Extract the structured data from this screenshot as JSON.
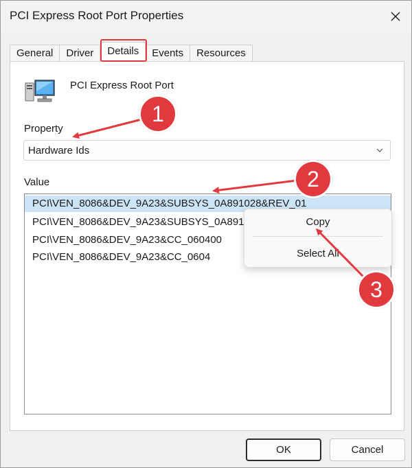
{
  "window": {
    "title": "PCI Express Root Port Properties",
    "close_glyph": "✕"
  },
  "tabs": [
    {
      "label": "General",
      "active": false
    },
    {
      "label": "Driver",
      "active": false
    },
    {
      "label": "Details",
      "active": true
    },
    {
      "label": "Events",
      "active": false
    },
    {
      "label": "Resources",
      "active": false
    }
  ],
  "device": {
    "name": "PCI Express Root Port",
    "icon": "network-adapter-icon"
  },
  "property": {
    "label": "Property",
    "selected": "Hardware Ids"
  },
  "value": {
    "label": "Value",
    "items": [
      "PCI\\VEN_8086&DEV_9A23&SUBSYS_0A891028&REV_01",
      "PCI\\VEN_8086&DEV_9A23&SUBSYS_0A891028",
      "PCI\\VEN_8086&DEV_9A23&CC_060400",
      "PCI\\VEN_8086&DEV_9A23&CC_0604"
    ],
    "selected_index": 0
  },
  "context_menu": {
    "items": [
      "Copy",
      "Select All"
    ]
  },
  "buttons": {
    "ok": "OK",
    "cancel": "Cancel"
  },
  "annotations": {
    "callouts": [
      "1",
      "2",
      "3"
    ],
    "color": "#e2393f"
  }
}
